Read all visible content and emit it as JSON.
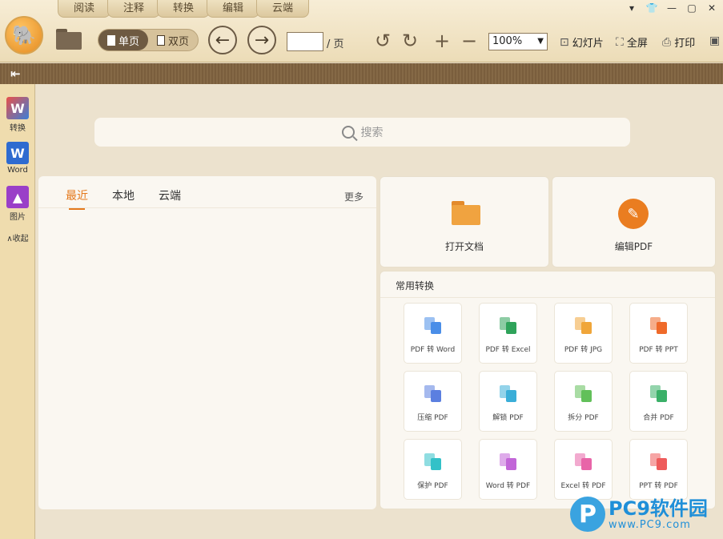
{
  "menu_tabs": [
    "阅读",
    "注释",
    "转换",
    "编辑",
    "云端"
  ],
  "window_controls": [
    "▾",
    "👕",
    "—",
    "▢",
    "✕"
  ],
  "toolbar": {
    "single_page": "单页",
    "double_page": "双页",
    "page_suffix": "/ 页",
    "page_value": "",
    "zoom": "100%",
    "slideshow": "幻灯片",
    "fullscreen": "全屏",
    "print": "打印"
  },
  "rail": {
    "convert": "转换",
    "word": "Word",
    "image": "图片",
    "collapse": "∧收起"
  },
  "search": {
    "placeholder": "搜索"
  },
  "recent": {
    "tabs": [
      "最近",
      "本地",
      "云端"
    ],
    "more": "更多"
  },
  "cards": {
    "open": "打开文档",
    "edit": "编辑PDF"
  },
  "conversions": {
    "title": "常用转换",
    "items": [
      {
        "label": "PDF 转 Word",
        "color": "#4a8ee8"
      },
      {
        "label": "PDF 转 Excel",
        "color": "#2fa35a"
      },
      {
        "label": "PDF 转 JPG",
        "color": "#f0a63a"
      },
      {
        "label": "PDF 转 PPT",
        "color": "#ef6a2a"
      },
      {
        "label": "压缩 PDF",
        "color": "#5b7fe0"
      },
      {
        "label": "解锁 PDF",
        "color": "#3aaed8"
      },
      {
        "label": "拆分 PDF",
        "color": "#62c05a"
      },
      {
        "label": "合并 PDF",
        "color": "#3ab068"
      },
      {
        "label": "保护 PDF",
        "color": "#33c1c8"
      },
      {
        "label": "Word 转 PDF",
        "color": "#c266d8"
      },
      {
        "label": "Excel 转 PDF",
        "color": "#e865a8"
      },
      {
        "label": "PPT 转 PDF",
        "color": "#ee5b5b"
      }
    ]
  },
  "watermark": {
    "brand": "PC9软件园",
    "url": "www.PC9.com"
  }
}
